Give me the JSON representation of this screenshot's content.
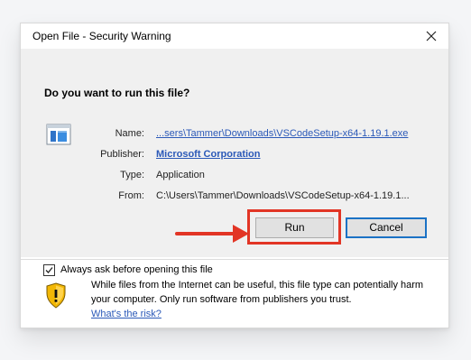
{
  "window": {
    "title": "Open File - Security Warning",
    "close_label": "×"
  },
  "main": {
    "question": "Do you want to run this file?",
    "fields": [
      {
        "label": "Name:",
        "value": "...sers\\Tammer\\Downloads\\VSCodeSetup-x64-1.19.1.exe"
      },
      {
        "label": "Publisher:",
        "value": "Microsoft Corporation"
      },
      {
        "label": "Type:",
        "value": "Application"
      },
      {
        "label": "From:",
        "value": "C:\\Users\\Tammer\\Downloads\\VSCodeSetup-x64-1.19.1..."
      }
    ],
    "buttons": {
      "run": "Run",
      "cancel": "Cancel"
    },
    "checkbox": {
      "label": "Always ask before opening this file",
      "checked": true
    }
  },
  "footer": {
    "warning_text": "While files from the Internet can be useful, this file type can potentially harm your computer. Only run software from publishers you trust.",
    "link_label": "What's the risk?"
  },
  "icons": {
    "app": "application-icon",
    "arrow": "red-arrow-icon",
    "shield": "warning-shield-icon",
    "close": "close-icon",
    "check": "check-icon"
  },
  "colors": {
    "accent": "#2b59b8",
    "highlight": "#e23525",
    "background": "#f0f0f0"
  }
}
